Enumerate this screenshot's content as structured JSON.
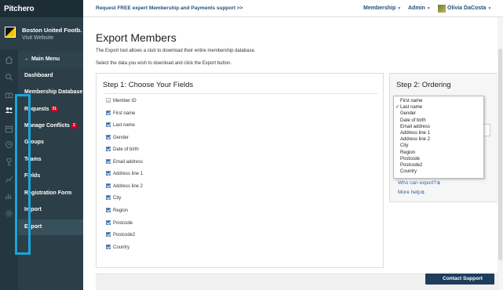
{
  "app": {
    "logo": "Pitchero"
  },
  "topbar": {
    "promo": "Request FREE expert Membership and Payments support >>",
    "nav_membership": "Membership",
    "nav_admin": "Admin",
    "user_name": "Olivia DaCosta"
  },
  "club": {
    "name": "Boston United Footb...",
    "visit": "Visit Website"
  },
  "menu": {
    "main_menu": "Main Menu",
    "items": [
      {
        "label": "Dashboard"
      },
      {
        "label": "Membership Database"
      },
      {
        "label": "Requests",
        "badge": "31"
      },
      {
        "label": "Manage Conflicts",
        "badge": "2"
      },
      {
        "label": "Groups"
      },
      {
        "label": "Teams"
      },
      {
        "label": "Fields"
      },
      {
        "label": "Registration Form"
      },
      {
        "label": "Import"
      },
      {
        "label": "Export"
      }
    ]
  },
  "main": {
    "title": "Export Members",
    "desc1": "The Export tool allows a club to download their entire membership database.",
    "desc2": "Select the data you wish to download and click the Export button."
  },
  "step1": {
    "title": "Step 1: Choose Your Fields",
    "fields": [
      {
        "label": "Member ID",
        "checked": false
      },
      {
        "label": "First name",
        "checked": true
      },
      {
        "label": "Last name",
        "checked": true
      },
      {
        "label": "Gender",
        "checked": true
      },
      {
        "label": "Date of birth",
        "checked": true
      },
      {
        "label": "Email address",
        "checked": true
      },
      {
        "label": "Address line 1",
        "checked": true
      },
      {
        "label": "Address line 2",
        "checked": true
      },
      {
        "label": "City",
        "checked": true
      },
      {
        "label": "Region",
        "checked": true
      },
      {
        "label": "Postcode",
        "checked": true
      },
      {
        "label": "Postcode2",
        "checked": true
      },
      {
        "label": "Country",
        "checked": true
      }
    ]
  },
  "step2": {
    "title": "Step 2: Ordering",
    "options": [
      "First name",
      "Last name",
      "Gender",
      "Date of birth",
      "Email address",
      "Address line 1",
      "Address line 2",
      "City",
      "Region",
      "Postcode",
      "Postcode2",
      "Country"
    ],
    "selected": "Last name",
    "selected_mark": "✓",
    "who_link": "Who can export?",
    "more_link": "More help"
  },
  "support": {
    "label": "Contact Support"
  },
  "colors": {
    "sidebar": "#2c3f49",
    "accent": "#24517a",
    "highlight": "#17a6da",
    "badge": "#d0021b"
  }
}
